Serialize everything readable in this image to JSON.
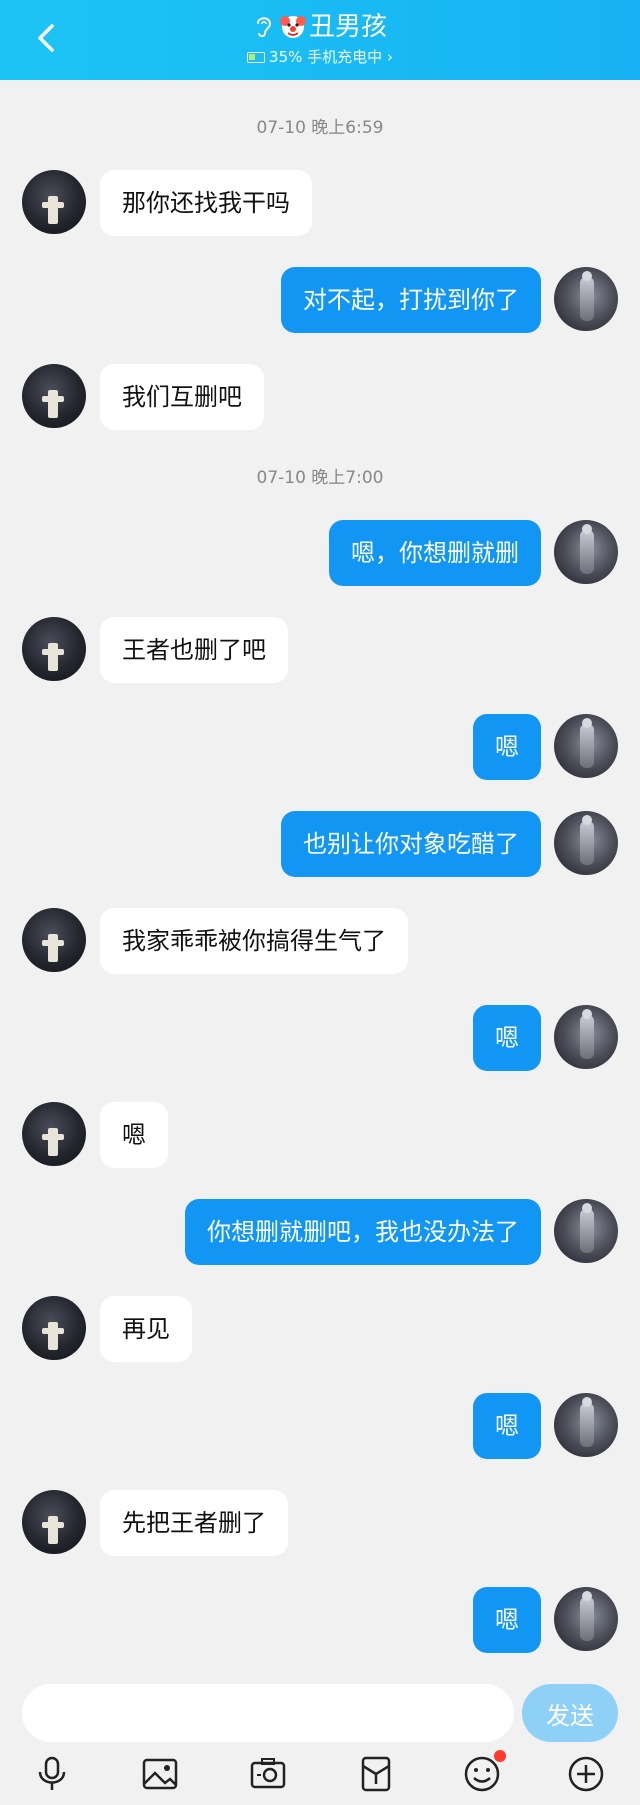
{
  "header": {
    "contact_name": "丑男孩",
    "status": "35% 手机充电中",
    "status_chevron": "›",
    "colors": {
      "bar": "#1cc4f4",
      "battery_fill": "#b7f36b"
    },
    "icons": [
      "back-icon",
      "ear-icon",
      "clown-icon",
      "battery-icon"
    ]
  },
  "timestamps": [
    "07-10 晚上6:59",
    "07-10 晚上7:00"
  ],
  "messages": [
    {
      "side": "left",
      "text": "那你还找我干吗"
    },
    {
      "side": "right",
      "text": "对不起，打扰到你了"
    },
    {
      "side": "left",
      "text": "我们互删吧"
    },
    {
      "side": "right",
      "text": "嗯，你想删就删"
    },
    {
      "side": "left",
      "text": "王者也删了吧"
    },
    {
      "side": "right",
      "text": "嗯"
    },
    {
      "side": "right",
      "text": "也别让你对象吃醋了"
    },
    {
      "side": "left",
      "text": "我家乖乖被你搞得生气了"
    },
    {
      "side": "right",
      "text": "嗯"
    },
    {
      "side": "left",
      "text": "嗯"
    },
    {
      "side": "right",
      "text": "你想删就删吧，我也没办法了"
    },
    {
      "side": "left",
      "text": "再见"
    },
    {
      "side": "right",
      "text": "嗯"
    },
    {
      "side": "left",
      "text": "先把王者删了"
    },
    {
      "side": "right",
      "text": "嗯"
    }
  ],
  "composer": {
    "input_value": "",
    "send_label": "发送",
    "tools": [
      "microphone-icon",
      "image-icon",
      "camera-icon",
      "red-packet-icon",
      "emoji-icon",
      "plus-icon"
    ],
    "colors": {
      "send": "#8ed0f6",
      "outgoing_bubble": "#1296f4",
      "notification_dot": "#ff3b30"
    }
  }
}
